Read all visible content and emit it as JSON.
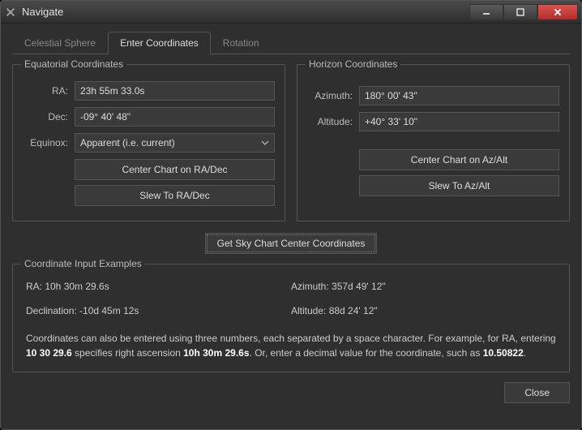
{
  "window": {
    "title": "Navigate"
  },
  "tabs": {
    "celestial": "Celestial Sphere",
    "enter": "Enter Coordinates",
    "rotation": "Rotation"
  },
  "equatorial": {
    "title": "Equatorial Coordinates",
    "ra_label": "RA:",
    "ra_value": "23h 55m 33.0s",
    "dec_label": "Dec:",
    "dec_value": "-09° 40' 48\"",
    "equinox_label": "Equinox:",
    "equinox_value": "Apparent (i.e. current)",
    "center_btn": "Center Chart on RA/Dec",
    "slew_btn": "Slew To RA/Dec"
  },
  "horizon": {
    "title": "Horizon Coordinates",
    "az_label": "Azimuth:",
    "az_value": "180° 00' 43\"",
    "alt_label": "Altitude:",
    "alt_value": "+40° 33' 10\"",
    "center_btn": "Center Chart on Az/Alt",
    "slew_btn": "Slew To Az/Alt"
  },
  "get_center_btn": "Get Sky Chart Center Coordinates",
  "examples": {
    "title": "Coordinate Input Examples",
    "ra": "RA:  10h 30m 29.6s",
    "dec": "Declination:  -10d 45m 12s",
    "az": "Azimuth: 357d 49' 12\"",
    "alt": "Altitude: 88d 24' 12\"",
    "note_prefix": "Coordinates can also be entered using three numbers, each separated by a space character. For example, for RA, entering ",
    "note_bold1": "10 30 29.6",
    "note_mid": " specifies right ascension ",
    "note_bold2": "10h 30m 29.6s",
    "note_mid2": ". Or, enter a decimal value for the coordinate, such as ",
    "note_bold3": "10.50822",
    "note_end": "."
  },
  "footer": {
    "close": "Close"
  }
}
